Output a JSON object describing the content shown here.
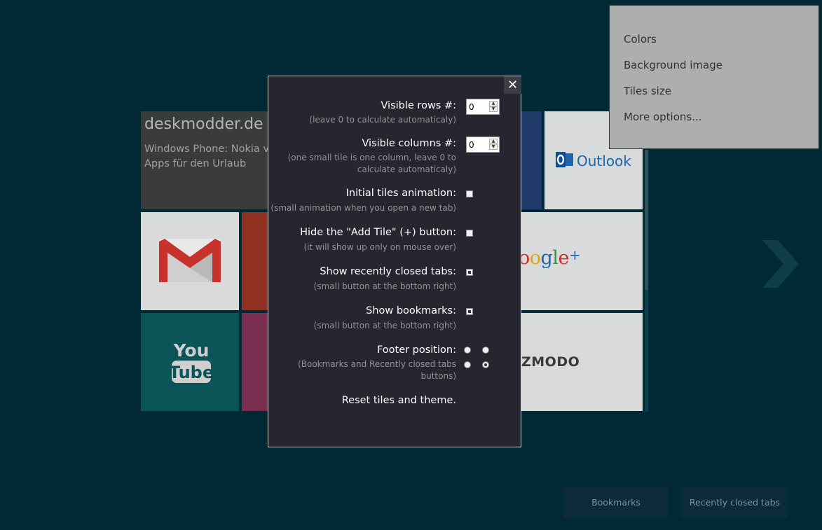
{
  "tiles": {
    "desk_title": "deskmodder.de",
    "desk_sub_line1": "Windows Phone: Nokia ve",
    "desk_sub_line2": "Apps für den Urlaub",
    "youtube_you": "You",
    "youtube_tube": "Tube",
    "outlook": "Outlook",
    "gplus": "oogle",
    "gplus_plus": "+",
    "gizmodo": "ZMODO"
  },
  "menu": {
    "items": [
      "Colors",
      "Background image",
      "Tiles size",
      "More options..."
    ]
  },
  "dialog": {
    "close": "✕",
    "options": [
      {
        "label": "Visible rows #:",
        "hint": "(leave 0 to calculate automaticaly)",
        "value": "0"
      },
      {
        "label": "Visible columns #:",
        "hint_line1": "(one small tile is one column, leave 0 to",
        "hint_line2": "calculate automaticaly)",
        "value": "0"
      },
      {
        "label": "Initial tiles animation:",
        "hint": "(small animation when you open a new tab)",
        "checked": false
      },
      {
        "label": "Hide the \"Add Tile\" (+) button:",
        "hint": "(it will show up only on mouse over)",
        "checked": false
      },
      {
        "label": "Show recently closed tabs:",
        "hint": "(small button at the bottom right)",
        "checked": true
      },
      {
        "label": "Show bookmarks:",
        "hint": "(small button at the bottom right)",
        "checked": true
      },
      {
        "label": "Footer position:",
        "hint_line1": "(Bookmarks and Recently closed tabs",
        "hint_line2": "buttons)",
        "selected": "bottom-right"
      }
    ],
    "reset": "Reset tiles and theme."
  },
  "footer": {
    "bookmarks": "Bookmarks",
    "recently_closed": "Recently closed tabs"
  },
  "colors": {
    "background": "#002935",
    "dialog_bg": "#252630",
    "menu_bg": "#adaeae"
  }
}
